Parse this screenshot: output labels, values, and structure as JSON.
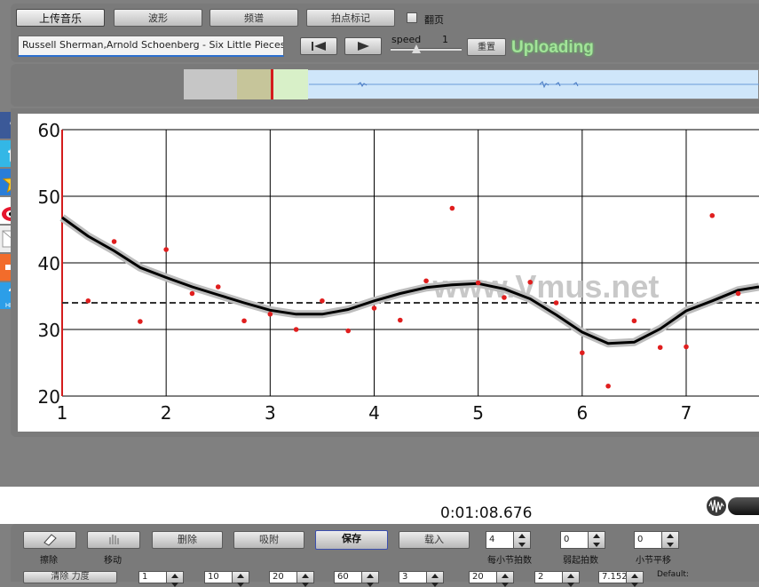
{
  "toolbar": {
    "upload_music": "上传音乐",
    "waveform": "波形",
    "spectrum": "频谱",
    "beat_marks": "拍点标记",
    "page_turn": "翻页",
    "track_title": "Russell Sherman,Arnold Schoenberg - Six Little Pieces for P",
    "speed_label": "speed",
    "speed_value": "1",
    "reset": "重置",
    "status": "Uploading"
  },
  "plot": {
    "watermark": "www.Vmus.net"
  },
  "chart_data": {
    "type": "line",
    "xlim": [
      1,
      7.7
    ],
    "ylim": [
      20,
      60
    ],
    "xticks": [
      "1",
      "2",
      "3",
      "4",
      "5",
      "6",
      "7"
    ],
    "yticks": [
      "20",
      "30",
      "40",
      "50",
      "60"
    ],
    "grid": true,
    "reference_line_y": 34,
    "series": [
      {
        "kind": "curve",
        "x": [
          1.0,
          1.25,
          1.5,
          1.75,
          2.0,
          2.25,
          2.5,
          2.75,
          3.0,
          3.25,
          3.5,
          3.75,
          4.0,
          4.25,
          4.5,
          4.75,
          5.0,
          5.25,
          5.5,
          5.75,
          6.0,
          6.25,
          6.5,
          6.75,
          7.0,
          7.25,
          7.5,
          7.7
        ],
        "y": [
          46.8,
          44.0,
          41.8,
          39.3,
          37.8,
          36.4,
          35.2,
          34.0,
          32.9,
          32.3,
          32.3,
          33.0,
          34.3,
          35.4,
          36.3,
          36.7,
          36.9,
          36.1,
          34.6,
          32.2,
          29.6,
          27.9,
          28.1,
          30.1,
          32.8,
          34.3,
          35.9,
          36.4
        ]
      },
      {
        "kind": "points",
        "x": [
          1.25,
          1.5,
          1.75,
          2.0,
          2.25,
          2.5,
          2.75,
          3.0,
          3.25,
          3.5,
          3.75,
          4.0,
          4.25,
          4.5,
          4.75,
          5.0,
          5.25,
          5.5,
          5.75,
          6.0,
          6.25,
          6.5,
          6.75,
          7.0,
          7.25,
          7.5
        ],
        "y": [
          34.3,
          43.2,
          31.2,
          42.0,
          35.4,
          36.4,
          31.3,
          32.3,
          30.0,
          34.3,
          29.8,
          33.2,
          31.4,
          37.3,
          48.2,
          37.0,
          34.8,
          37.1,
          34.0,
          26.5,
          21.5,
          31.3,
          27.3,
          27.4,
          47.1,
          35.4
        ]
      }
    ]
  },
  "timer": "0:01:08.676",
  "bottom": {
    "erase": "擦除",
    "move": "移动",
    "delete": "删除",
    "snap": "吸附",
    "save": "保存",
    "load": "载入",
    "beats_per_bar_value": "4",
    "beats_per_bar_label": "每小节拍数",
    "pickup_value": "0",
    "pickup_label": "弱起拍数",
    "bar_offset_value": "0",
    "bar_offset_label": "小节平移",
    "clear_label": "清除 力度",
    "row2_values": [
      "1",
      "10",
      "20",
      "60",
      "3",
      "20",
      "2",
      "7.152"
    ],
    "default_label": "Default:"
  },
  "colors": {
    "panel": "#7a7a7a",
    "uploading": "#a3e39a",
    "points": "#e01e1e",
    "curve": "#000000"
  }
}
